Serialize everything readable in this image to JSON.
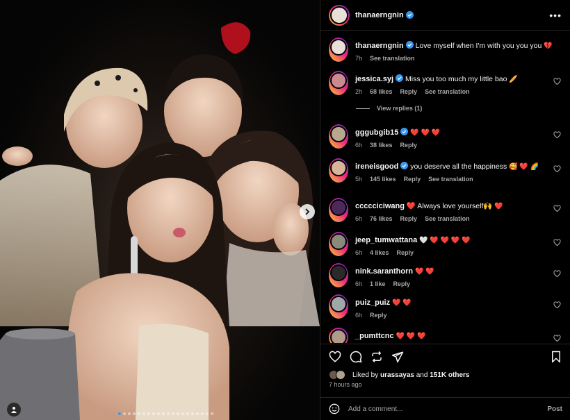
{
  "post": {
    "author": "thanaerngnin",
    "more_label": "•••"
  },
  "caption": {
    "user": "thanaerngnin",
    "text": "Love myself when I'm with you you you",
    "emoji": "💔",
    "time": "7h",
    "translate": "See translation"
  },
  "comments": [
    {
      "user": "jessica.syj",
      "verified": true,
      "text": "Miss you too much my little bao",
      "emoji": "🥖",
      "time": "2h",
      "likes": "68 likes",
      "reply": "Reply",
      "translate": "See translation",
      "avatar_color": "#c98a8f"
    },
    {
      "user": "gggubgib15",
      "verified": true,
      "text": "",
      "emoji": "❤️ ❤️ ❤️",
      "time": "6h",
      "likes": "38 likes",
      "reply": "Reply",
      "translate": "",
      "avatar_color": "#b8a88e"
    },
    {
      "user": "ireneisgood",
      "verified": true,
      "text": "you deserve all the happiness",
      "emoji": "🥰 ❤️ 🌈",
      "time": "5h",
      "likes": "145 likes",
      "reply": "Reply",
      "translate": "See translation",
      "avatar_color": "#d9b39a"
    },
    {
      "user": "ccccciciwang",
      "verified": false,
      "text": "❤️ Always love yourself🙌",
      "emoji": "❤️",
      "time": "6h",
      "likes": "76 likes",
      "reply": "Reply",
      "translate": "See translation",
      "avatar_color": "#4a2a5a"
    },
    {
      "user": "jeep_tumwattana",
      "verified": false,
      "text": "",
      "emoji": "🤍 ❤️ ❤️ ❤️ ❤️",
      "time": "6h",
      "likes": "4 likes",
      "reply": "Reply",
      "translate": "",
      "avatar_color": "#8a8a7a"
    },
    {
      "user": "nink.saranthorn",
      "verified": false,
      "text": "",
      "emoji": "❤️ ❤️",
      "time": "6h",
      "likes": "1 like",
      "reply": "Reply",
      "translate": "",
      "avatar_color": "#2a2a2a"
    },
    {
      "user": "puiz_puiz",
      "verified": false,
      "text": "",
      "emoji": "❤️ ❤️",
      "time": "6h",
      "likes": "",
      "reply": "Reply",
      "translate": "",
      "avatar_color": "#a0a8a8"
    },
    {
      "user": "_pumttcnc",
      "verified": false,
      "text": "",
      "emoji": "❤️ ❤️ ❤️",
      "time": "",
      "likes": "",
      "reply": "",
      "translate": "",
      "avatar_color": "#b09a8a"
    }
  ],
  "view_replies": "View replies (1)",
  "liked_by": {
    "prefix": "Liked by",
    "user": "urassayas",
    "and": "and",
    "count": "151K others"
  },
  "time_ago": "7 hours ago",
  "add_comment": {
    "placeholder": "Add a comment...",
    "post": "Post"
  },
  "colors": {
    "accent": "#3897f0",
    "heart": "#ff3040",
    "muted": "#a8a8a8",
    "panel_bg": "#000000"
  },
  "carousel": {
    "slide_count": 20,
    "active_index": 0
  }
}
